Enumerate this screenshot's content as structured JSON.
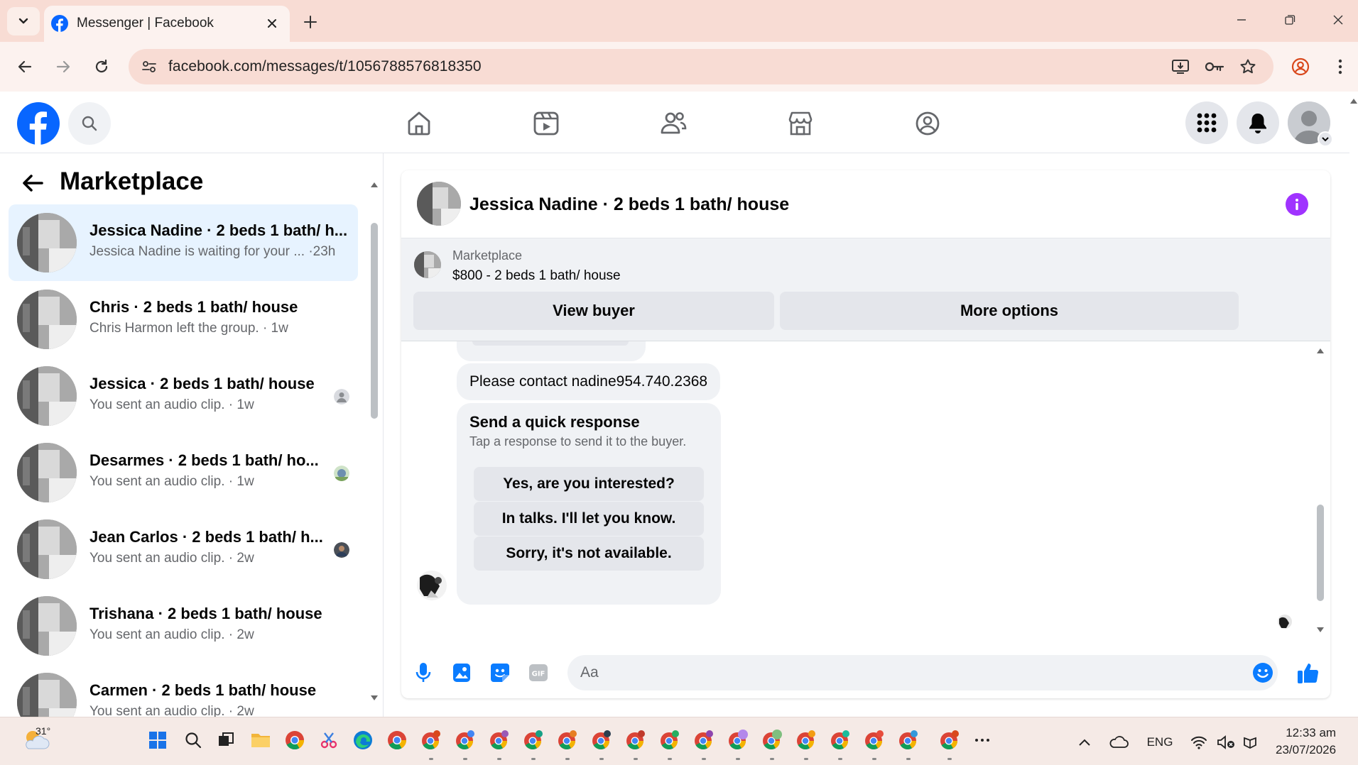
{
  "browser": {
    "tab_title": "Messenger | Facebook",
    "url": "facebook.com/messages/t/1056788576818350"
  },
  "left_panel": {
    "title": "Marketplace",
    "conversations": [
      {
        "name": "Jessica Nadine · 2 beds 1 bath/ h...",
        "preview": "Jessica Nadine is waiting for your ... ·23h",
        "active": true
      },
      {
        "name": "Chris · 2 beds 1 bath/ house",
        "preview": "Chris Harmon left the group. · 1w",
        "active": false
      },
      {
        "name": "Jessica · 2 beds 1 bath/ house",
        "preview": "You sent an audio clip. · 1w",
        "active": false
      },
      {
        "name": "Desarmes · 2 beds 1 bath/ ho...",
        "preview": "You sent an audio clip. · 1w",
        "active": false
      },
      {
        "name": "Jean Carlos · 2 beds 1 bath/ h...",
        "preview": "You sent an audio clip. · 2w",
        "active": false
      },
      {
        "name": "Trishana · 2 beds 1 bath/ house",
        "preview": "You sent an audio clip. · 2w",
        "active": false
      },
      {
        "name": "Carmen · 2 beds 1 bath/ house",
        "preview": "You sent an audio clip. · 2w",
        "active": false
      }
    ]
  },
  "chat": {
    "title": "Jessica Nadine · 2 beds 1 bath/ house",
    "marketplace_label": "Marketplace",
    "listing": "$800 - 2 beds 1 bath/ house",
    "view_buyer_label": "View buyer",
    "more_options_label": "More options",
    "message_contact": "Please contact nadine954.740.2368",
    "quick_response": {
      "title": "Send a quick response",
      "subtitle": "Tap a response to send it to the buyer.",
      "options": [
        "Yes, are you interested?",
        "In talks. I'll let you know.",
        "Sorry, it's not available."
      ]
    },
    "composer_placeholder": "Aa"
  },
  "taskbar": {
    "temperature": "31°",
    "language": "ENG",
    "time": "12:33 am",
    "date": "23/07/2026"
  },
  "colors": {
    "facebook_blue": "#0866ff",
    "messenger_blue": "#0a7cff",
    "info_purple": "#a033ff",
    "active_conversation": "#e7f3ff",
    "chrome_tab_bar": "#f8dcd4"
  }
}
